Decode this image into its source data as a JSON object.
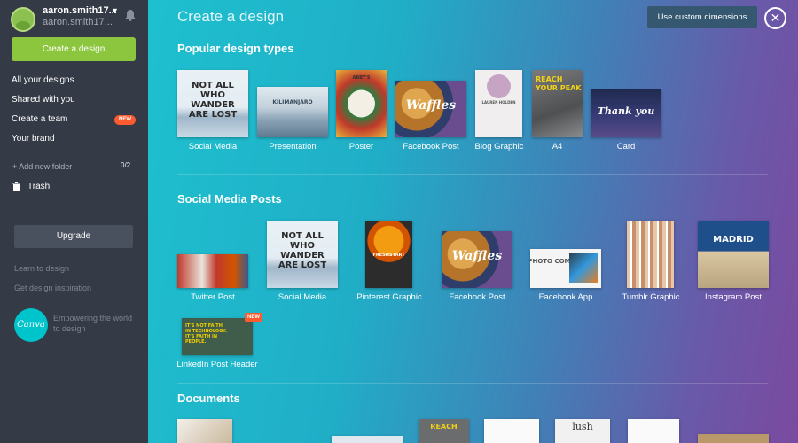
{
  "user": {
    "name": "aaron.smith17...",
    "account": "aaron.smith17..."
  },
  "sidebar": {
    "create_label": "Create a design",
    "items": [
      {
        "label": "All your designs"
      },
      {
        "label": "Shared with you"
      },
      {
        "label": "Create a team",
        "badge": "NEW"
      },
      {
        "label": "Your brand"
      }
    ],
    "add_folder": "+ Add new folder",
    "folder_count": "0/2",
    "trash": "Trash",
    "upgrade": "Upgrade",
    "learn": "Learn to design",
    "inspiration": "Get design inspiration",
    "logo": "Canva",
    "tagline": "Empowering the world to design"
  },
  "main": {
    "title": "Create a design",
    "custom_dimensions": "Use custom dimensions",
    "close": "✕",
    "popular": {
      "title": "Popular design types",
      "items": [
        {
          "label": "Social Media",
          "thumb_text": "NOT ALL WHO WANDER ARE LOST"
        },
        {
          "label": "Presentation",
          "thumb_text": "KILIMANJARO"
        },
        {
          "label": "Poster",
          "thumb_text": "ABBY'S"
        },
        {
          "label": "Facebook Post",
          "thumb_text": "Waffles"
        },
        {
          "label": "Blog Graphic",
          "thumb_text": "LAUREN HOLDEN"
        },
        {
          "label": "A4",
          "thumb_text": "REACH YOUR PEAK"
        },
        {
          "label": "Card",
          "thumb_text": "Thank you"
        }
      ]
    },
    "social": {
      "title": "Social Media Posts",
      "items": [
        {
          "label": "Twitter Post",
          "thumb_text": ""
        },
        {
          "label": "Social Media",
          "thumb_text": "NOT ALL WHO WANDER ARE LOST"
        },
        {
          "label": "Pinterest Graphic",
          "thumb_text": "FRESHSTART"
        },
        {
          "label": "Facebook Post",
          "thumb_text": "Waffles"
        },
        {
          "label": "Facebook App",
          "thumb_text": "PHOTO COMP"
        },
        {
          "label": "Tumblr Graphic",
          "thumb_text": ""
        },
        {
          "label": "Instagram Post",
          "thumb_text": "MADRID"
        },
        {
          "label": "LinkedIn Post Header",
          "thumb_text": "IT'S NOT FAITH IN TECHNOLOGY. IT'S FAITH IN PEOPLE.",
          "badge": "NEW"
        }
      ]
    },
    "documents": {
      "title": "Documents",
      "items": [
        {
          "thumb_text": ""
        },
        {
          "thumb_text": ""
        },
        {
          "thumb_text": "REACH"
        },
        {
          "thumb_text": ""
        },
        {
          "thumb_text": "lush"
        },
        {
          "thumb_text": ""
        },
        {
          "thumb_text": ""
        }
      ]
    }
  },
  "colors": {
    "accent_green": "#8cc63f",
    "badge_red": "#ff5b31",
    "sidebar_bg": "#343a46",
    "canva_teal": "#00c4cc"
  }
}
